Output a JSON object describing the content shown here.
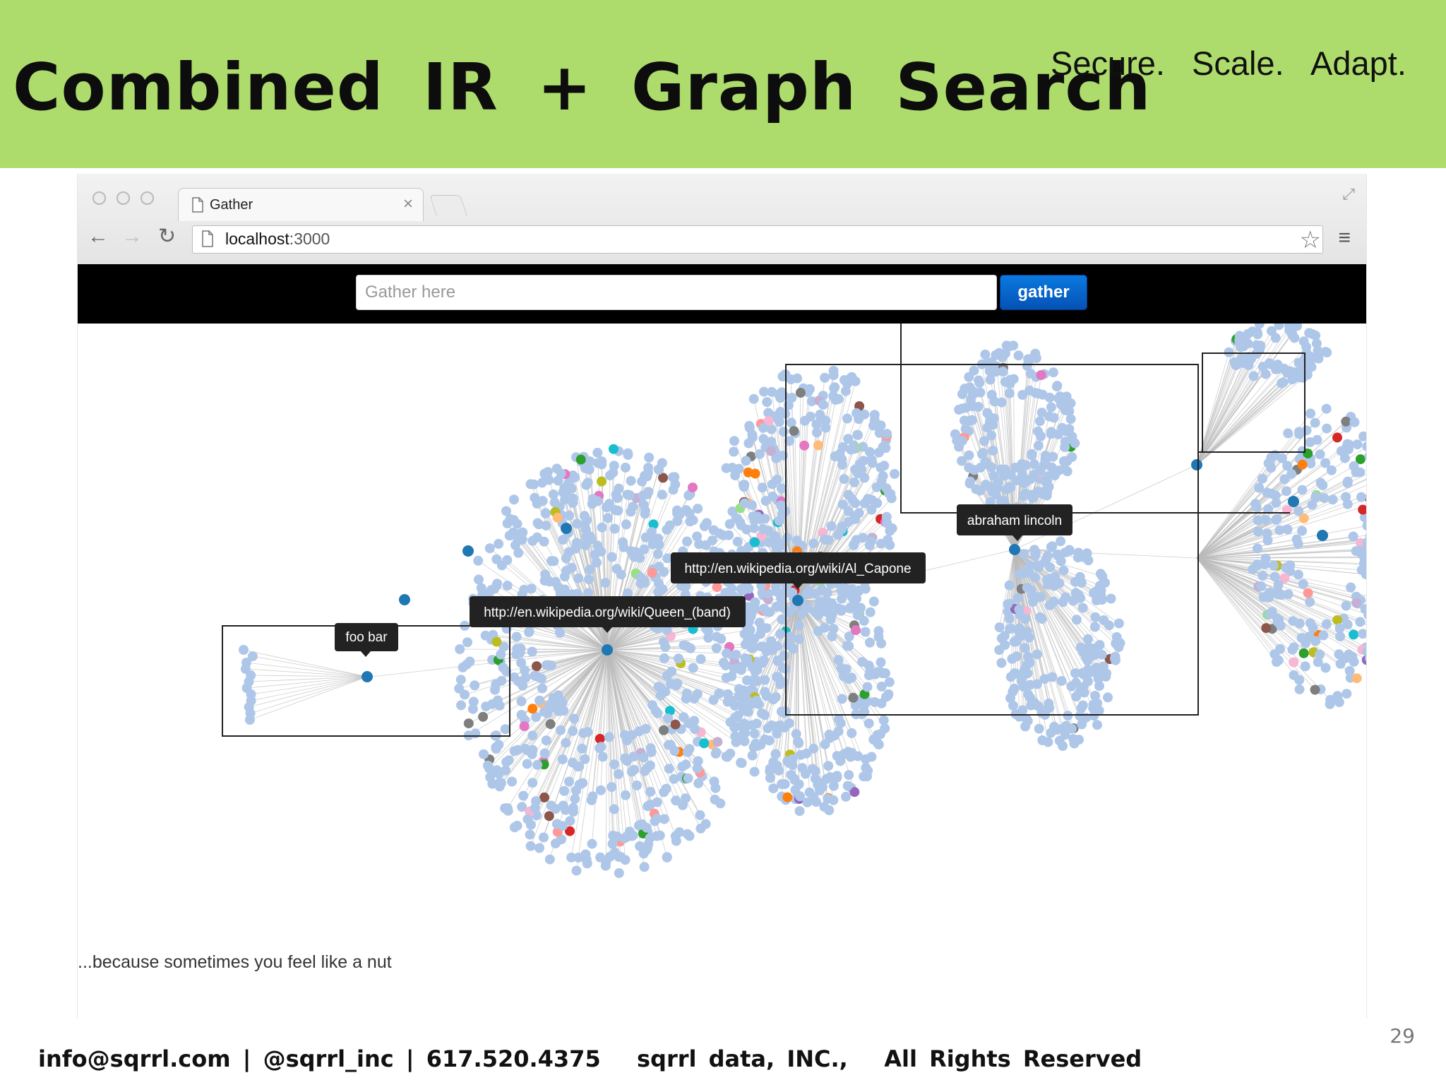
{
  "slide": {
    "title": "Combined IR + Graph Search",
    "taglines": [
      "Secure.",
      "Scale.",
      "Adapt."
    ],
    "page_number": "29",
    "footer_contact": "info@sqrrl.com | @sqrrl_inc | 617.520.4375",
    "footer_rights": "sqrrl data, INC.,   All Rights Reserved"
  },
  "browser": {
    "tab_title": "Gather",
    "url_host": "localhost",
    "url_port": ":3000",
    "icons": [
      "back-icon",
      "forward-icon",
      "reload-icon",
      "page-icon",
      "star-icon",
      "menu-icon",
      "close-icon",
      "resize-icon"
    ]
  },
  "app": {
    "search_placeholder": "Gather here",
    "search_value": "",
    "gather_button": "gather",
    "caption": "...because sometimes you feel like a nut"
  },
  "graph": {
    "tooltips": {
      "foo_bar": "foo bar",
      "queen": "http://en.wikipedia.org/wiki/Queen_(band)",
      "capone": "http://en.wikipedia.org/wiki/Al_Capone",
      "lincoln": "abraham lincoln"
    },
    "colors": {
      "node": "#aec7e8",
      "hub": "#1f77b4",
      "edge": "#bbbbbb",
      "accents": [
        "#d62728",
        "#ff7f0e",
        "#2ca02c",
        "#9467bd",
        "#8c564b",
        "#e377c2",
        "#7f7f7f",
        "#bcbd22",
        "#17becf",
        "#98df8a",
        "#ff9896",
        "#c5b0d5",
        "#ffbb78",
        "#f7b6d2"
      ]
    }
  }
}
